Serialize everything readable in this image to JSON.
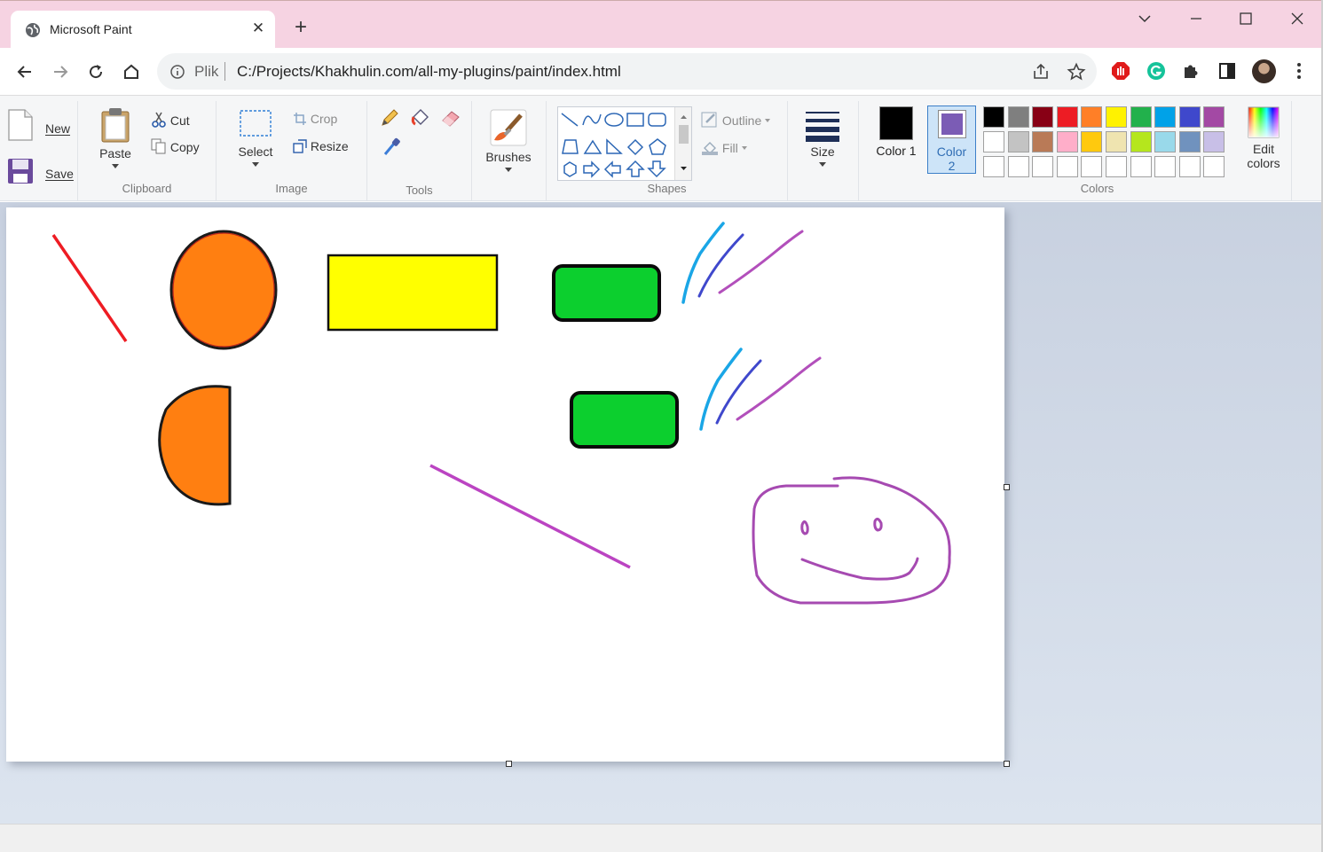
{
  "browser": {
    "tab_title": "Microsoft Paint",
    "omnibox_prefix": "Plik",
    "url": "C:/Projects/Khakhulin.com/all-my-plugins/paint/index.html"
  },
  "ribbon": {
    "file": {
      "new_label": "New",
      "save_label": "Save"
    },
    "clipboard": {
      "paste_label": "Paste",
      "cut_label": "Cut",
      "copy_label": "Copy",
      "group_label": "Clipboard"
    },
    "image": {
      "select_label": "Select",
      "crop_label": "Crop",
      "resize_label": "Resize",
      "group_label": "Image"
    },
    "tools": {
      "group_label": "Tools",
      "tool_icons": [
        "pencil-icon",
        "fill-bucket-icon",
        "eraser-icon",
        "color-picker-icon"
      ]
    },
    "brushes": {
      "label": "Brushes"
    },
    "shapes": {
      "group_label": "Shapes",
      "outline_label": "Outline",
      "fill_label": "Fill",
      "shape_icons": [
        "line",
        "curve",
        "oval",
        "rectangle",
        "rounded-rectangle",
        "polygon",
        "triangle",
        "right-triangle",
        "diamond",
        "pentagon",
        "hexagon",
        "right-arrow",
        "left-arrow",
        "up-arrow",
        "down-arrow"
      ]
    },
    "size": {
      "label": "Size"
    },
    "colors": {
      "group_label": "Colors",
      "color1_label": "Color 1",
      "color2_label": "Color 2",
      "color1": "#000000",
      "color2": "#7b5cb5",
      "edit_label": "Edit colors",
      "palette_row1": [
        "#000000",
        "#7f7f7f",
        "#880015",
        "#ed1c24",
        "#ff7f27",
        "#fff200",
        "#22b14c",
        "#00a2e8",
        "#3f48cc",
        "#a349a4"
      ],
      "palette_row2": [
        "#ffffff",
        "#c3c3c3",
        "#b97a57",
        "#ffaec9",
        "#ffc90e",
        "#efe4b0",
        "#b5e61d",
        "#99d9ea",
        "#7092be",
        "#c8bfe7"
      ],
      "palette_row3": [
        "",
        "",
        "",
        "",
        "",
        "",
        "",
        "",
        "",
        ""
      ]
    }
  },
  "canvas": {
    "drawings": [
      "red-line",
      "orange-circle",
      "yellow-rectangle",
      "green-rounded-rectangle",
      "blue-purple-strokes",
      "orange-half-circle",
      "green-rounded-rectangle-2",
      "blue-purple-strokes-2",
      "magenta-line",
      "smiley-face"
    ]
  }
}
